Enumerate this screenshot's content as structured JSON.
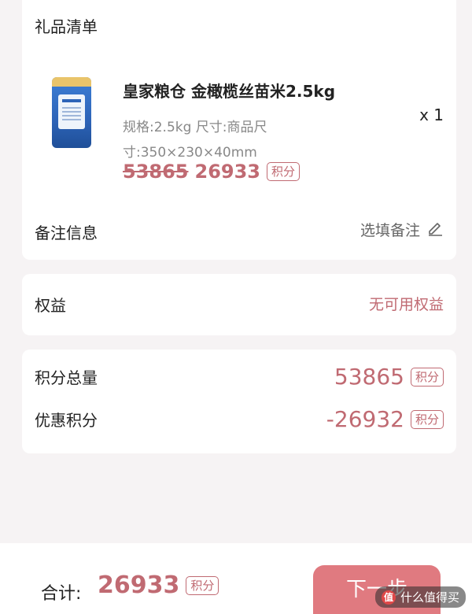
{
  "gift_list": {
    "title": "礼品清单",
    "product": {
      "image_icon": "rice-bag-image",
      "name": "皇家粮仓 金橄榄丝苗米2.5kg",
      "spec": "规格:2.5kg  尺寸:商品尺寸:350×230×40mm",
      "quantity": "x 1",
      "original_points": "53865",
      "current_points": "26933",
      "points_unit": "积分"
    },
    "remark": {
      "label": "备注信息",
      "action": "选填备注",
      "icon": "pencil-icon"
    }
  },
  "rights": {
    "label": "权益",
    "value": "无可用权益"
  },
  "points": {
    "total_label": "积分总量",
    "total_value": "53865",
    "discount_label": "优惠积分",
    "discount_value": "-26932",
    "unit": "积分"
  },
  "footer": {
    "total_label": "合计:",
    "total_amount": "26933",
    "unit": "积分",
    "next_button": "下一步"
  },
  "watermark": {
    "logo": "值",
    "text": "什么值得买"
  },
  "colors": {
    "accent": "#c06a72",
    "button": "#e07a80",
    "background": "#f6f3f4"
  }
}
